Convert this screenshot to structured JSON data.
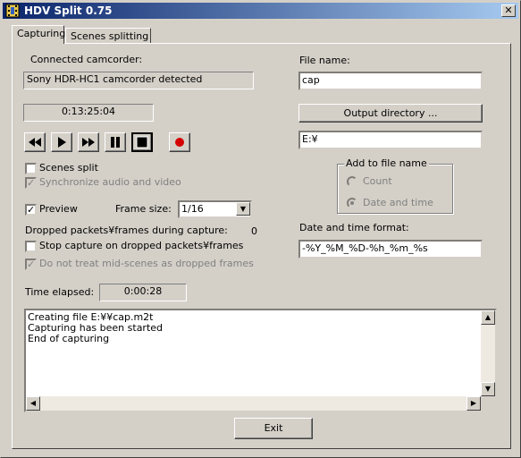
{
  "window": {
    "title": "HDV Split 0.75",
    "close_glyph": "✕"
  },
  "tabs": [
    {
      "label": "Capturing"
    },
    {
      "label": "Scenes splitting"
    }
  ],
  "camcorder": {
    "label": "Connected camcorder:",
    "value": "Sony HDR-HC1 camcorder detected"
  },
  "timecode": "0:13:25:04",
  "media_controls": [
    {
      "name": "rewind-icon",
      "glyph": "◀◀"
    },
    {
      "name": "play-icon",
      "glyph": "▶"
    },
    {
      "name": "fast-forward-icon",
      "glyph": "▶▶"
    },
    {
      "name": "pause-icon",
      "glyph": "❚❚"
    },
    {
      "name": "stop-icon",
      "glyph": "■"
    },
    {
      "name": "record-icon",
      "glyph": "●"
    }
  ],
  "scenes_split": {
    "label": "Scenes split",
    "checked": false
  },
  "sync_av": {
    "label": "Synchronize audio and video",
    "checked": true
  },
  "preview": {
    "label": "Preview",
    "checked": true
  },
  "frame_size": {
    "label": "Frame size:",
    "value": "1/16"
  },
  "dropped": {
    "label": "Dropped packets¥frames during capture:",
    "value": "0"
  },
  "stop_on_dropped": {
    "label": "Stop capture on dropped packets¥frames",
    "checked": false
  },
  "mid_scenes": {
    "label": "Do not treat mid-scenes as dropped frames",
    "checked": true
  },
  "time_elapsed": {
    "label": "Time elapsed:",
    "value": "0:00:28"
  },
  "file_name": {
    "label": "File name:",
    "value": "cap"
  },
  "output_dir": {
    "button": "Output directory ...",
    "value": "E:¥"
  },
  "add_to_file": {
    "label": "Add to file name",
    "options": [
      "Count",
      "Date and time"
    ],
    "selected": "Date and time"
  },
  "date_format": {
    "label": "Date and time format:",
    "value": "-%Y_%M_%D-%h_%m_%s"
  },
  "log": [
    "Creating file E:¥¥cap.m2t",
    "Capturing has been started",
    "End of capturing"
  ],
  "exit_label": "Exit",
  "colors": {
    "title_start": "#0a246a",
    "title_end": "#a6caf0",
    "record": "#d40000",
    "face": "#d4d0c8"
  }
}
